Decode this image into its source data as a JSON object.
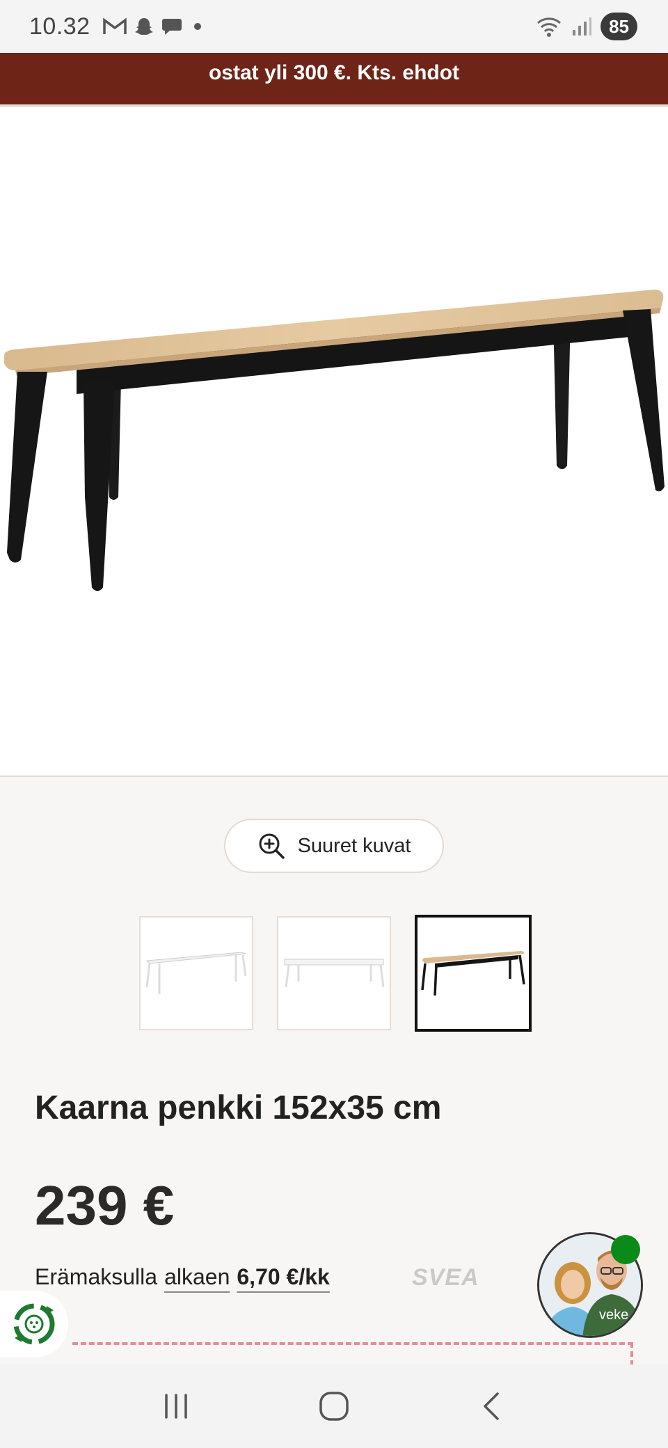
{
  "status_bar": {
    "time": "10.32",
    "battery": "85",
    "icons": [
      "gmail-icon",
      "snapchat-icon",
      "chat-bubble-icon",
      "dot-icon",
      "wifi-icon",
      "signal-icon"
    ]
  },
  "promo": {
    "text": "ostat yli 300 €. Kts. ehdot"
  },
  "gallery": {
    "zoom_label": "Suuret kuvat",
    "thumbnails": [
      "white-bench",
      "white-bench-alt",
      "oak-black-bench"
    ],
    "active_thumbnail": 2
  },
  "product": {
    "title": "Kaarna penkki 152x35 cm",
    "price": "239 €",
    "installment_prefix": "Erämaksulla",
    "installment_link": "alkaen",
    "installment_amount": "6,70 €/kk",
    "provider_logo": "SVEA"
  },
  "colors": {
    "banner": "#6e2417",
    "accent_dashed": "#e48c95",
    "online": "#0a8a18",
    "recycle_green": "#1d7a2e"
  },
  "nav": {
    "buttons": [
      "recent-apps",
      "home",
      "back"
    ]
  }
}
